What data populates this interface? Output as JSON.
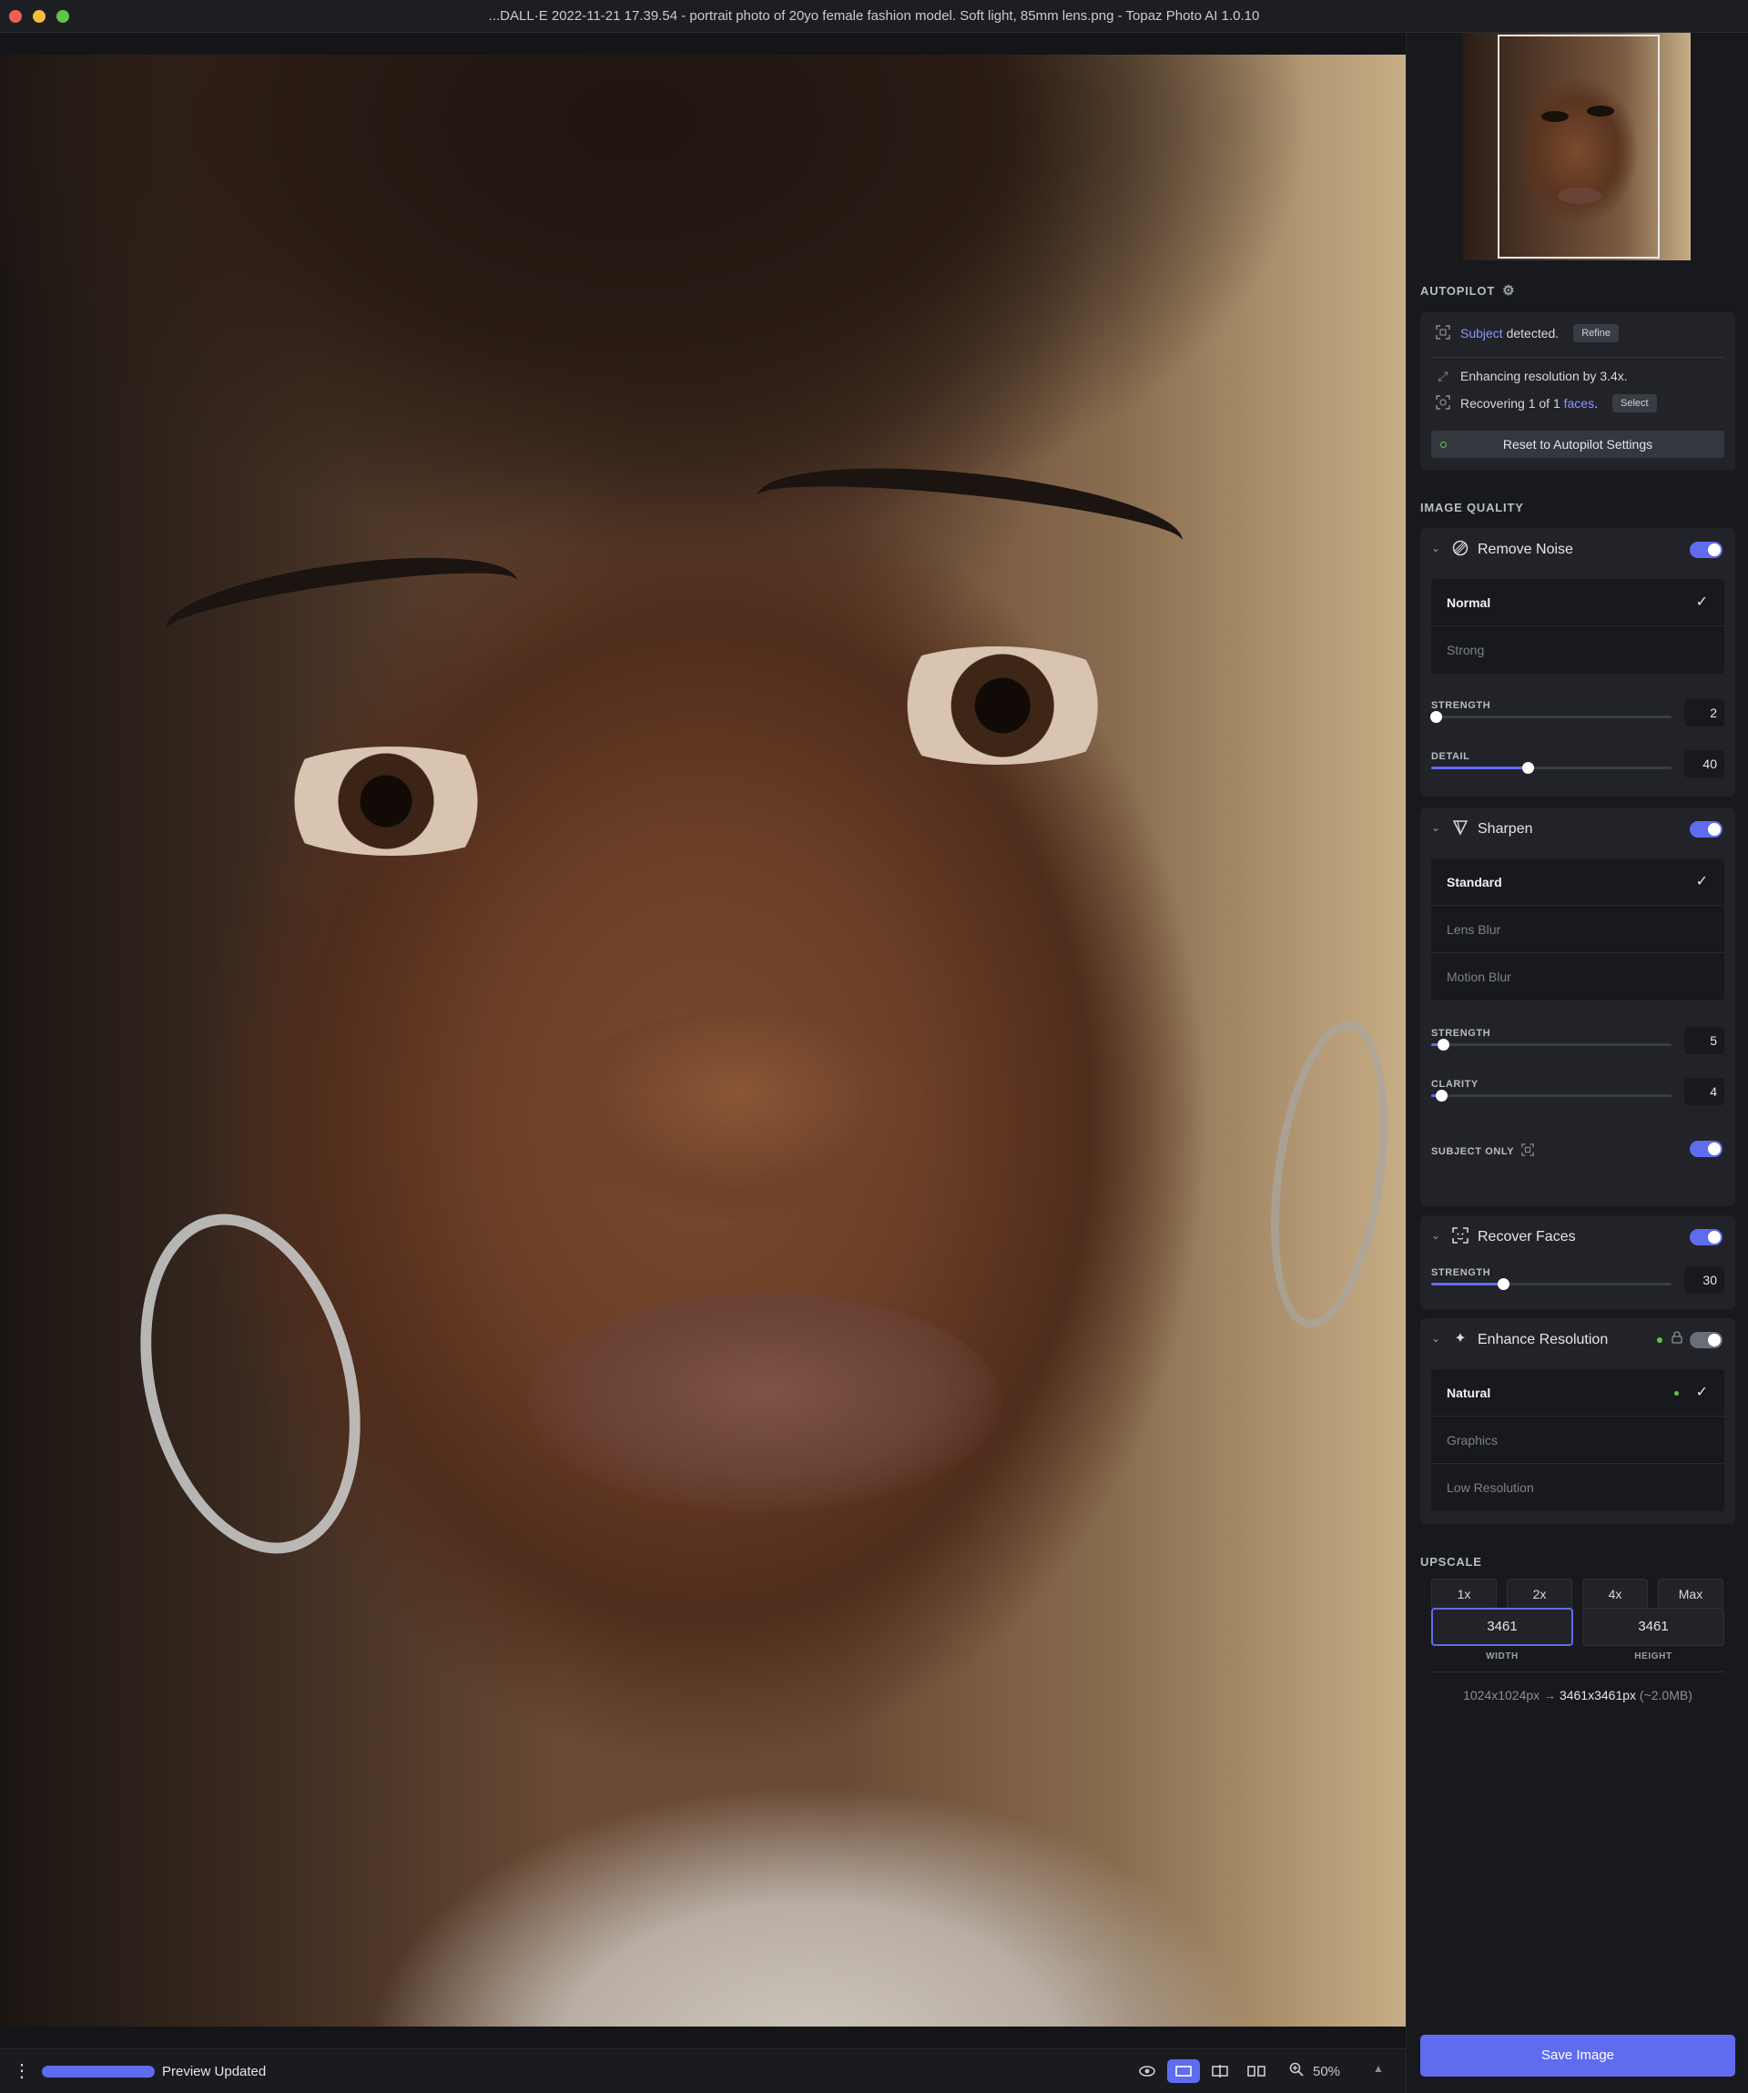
{
  "window": {
    "title": "...DALL·E 2022-11-21 17.39.54 - portrait photo of 20yo female fashion model. Soft light, 85mm lens.png - Topaz Photo AI 1.0.10"
  },
  "bottom_bar": {
    "progress_percent": 100,
    "status": "Preview Updated",
    "zoom": "50%",
    "view_modes": [
      "preview-eye",
      "single-view",
      "split-view",
      "side-by-side"
    ],
    "active_view": "single-view"
  },
  "autopilot": {
    "label": "AUTOPILOT",
    "subject_link": "Subject",
    "subject_rest": " detected.",
    "refine": "Refine",
    "enhancing": "Enhancing resolution by 3.4x.",
    "recovering_prefix": "Recovering 1 of 1 ",
    "faces_link": "faces",
    "recovering_suffix": ".",
    "select": "Select",
    "reset": "Reset to Autopilot Settings"
  },
  "image_quality": {
    "label": "IMAGE QUALITY",
    "remove_noise": {
      "title": "Remove Noise",
      "enabled": true,
      "options": [
        "Normal",
        "Strong"
      ],
      "selected": "Normal",
      "strength_label": "STRENGTH",
      "strength": "2",
      "strength_fraction": 0.02,
      "detail_label": "DETAIL",
      "detail": "40",
      "detail_fraction": 0.4
    },
    "sharpen": {
      "title": "Sharpen",
      "enabled": true,
      "options": [
        "Standard",
        "Lens Blur",
        "Motion Blur"
      ],
      "selected": "Standard",
      "strength_label": "STRENGTH",
      "strength": "5",
      "strength_fraction": 0.05,
      "clarity_label": "CLARITY",
      "clarity": "4",
      "clarity_fraction": 0.04,
      "subject_only_label": "SUBJECT ONLY",
      "subject_only": true
    },
    "recover_faces": {
      "title": "Recover Faces",
      "enabled": true,
      "strength_label": "STRENGTH",
      "strength": "30",
      "strength_fraction": 0.3
    },
    "enhance_resolution": {
      "title": "Enhance Resolution",
      "enabled": false,
      "options": [
        "Natural",
        "Graphics",
        "Low Resolution"
      ],
      "selected": "Natural"
    }
  },
  "upscale": {
    "label": "UPSCALE",
    "buttons": [
      "1x",
      "2x",
      "4x",
      "Max"
    ],
    "width": "3461",
    "height": "3461",
    "width_label": "WIDTH",
    "height_label": "HEIGHT",
    "source_size": "1024x1024px",
    "arrow": "→",
    "target_size": "3461x3461px",
    "file_size": "(~2.0MB)"
  },
  "save_button": "Save Image",
  "colors": {
    "accent": "#5f6cf0",
    "link": "#8c96ff",
    "status_green": "#5fc54b"
  }
}
